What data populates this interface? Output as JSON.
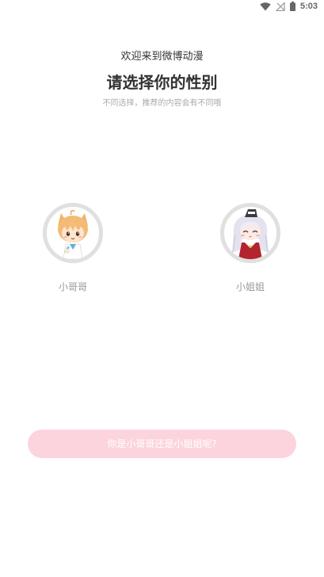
{
  "status_bar": {
    "time": "5:03",
    "icons": [
      "wifi-icon",
      "no-signal-icon",
      "battery-icon"
    ]
  },
  "header": {
    "welcome": "欢迎来到微博动漫",
    "title": "请选择你的性别",
    "subtitle": "不同选择，推荐的内容会有不同哦"
  },
  "options": [
    {
      "label": "小哥哥",
      "avatar": "boy-avatar-icon"
    },
    {
      "label": "小姐姐",
      "avatar": "girl-avatar-icon"
    }
  ],
  "confirm": {
    "label": "你是小哥哥还是小姐姐呢?"
  },
  "colors": {
    "button_bg": "#fcd4dd",
    "avatar_ring": "#e0e0e0",
    "title_text": "#333333",
    "muted_text": "#999999"
  }
}
